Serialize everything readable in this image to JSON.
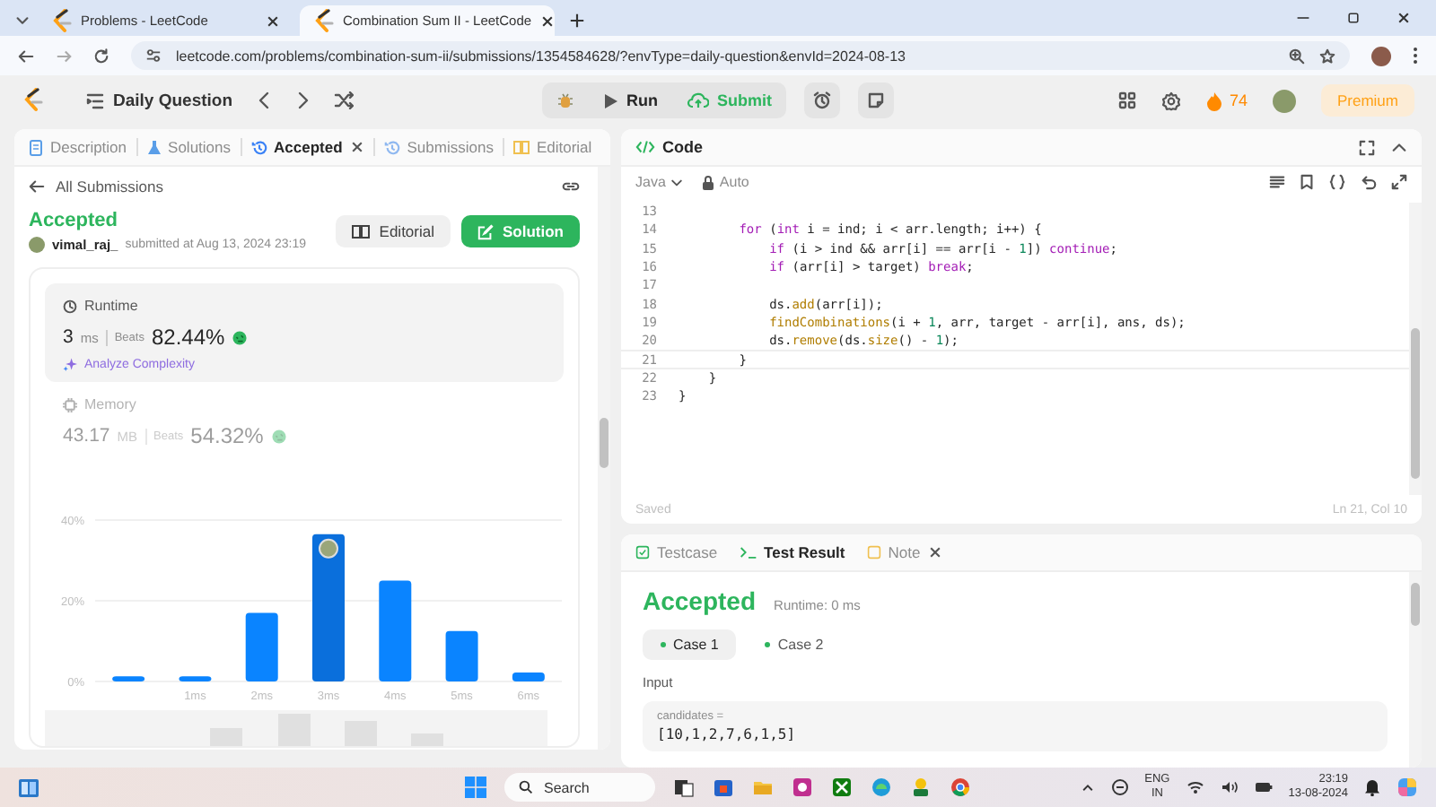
{
  "browser": {
    "tabs": [
      {
        "title": "Problems - LeetCode",
        "selected": false
      },
      {
        "title": "Combination Sum II - LeetCode",
        "selected": true
      }
    ],
    "url": "leetcode.com/problems/combination-sum-ii/submissions/1354584628/?envType=daily-question&envId=2024-08-13"
  },
  "nav": {
    "title": "Daily Question",
    "run": "Run",
    "submit": "Submit",
    "streak": "74",
    "premium": "Premium"
  },
  "submission_panel": {
    "tabs": [
      {
        "label": "Description",
        "selected": false,
        "closable": false
      },
      {
        "label": "Solutions",
        "selected": false,
        "closable": false
      },
      {
        "label": "Accepted",
        "selected": true,
        "closable": true
      },
      {
        "label": "Submissions",
        "selected": false,
        "closable": false
      },
      {
        "label": "Editorial",
        "selected": false,
        "closable": false
      }
    ],
    "back_link": "All Submissions",
    "status": "Accepted",
    "user": "vimal_raj_",
    "submitted": "submitted at Aug 13, 2024 23:19",
    "buttons": [
      "Editorial",
      "Solution"
    ],
    "metrics": [
      {
        "label": "Runtime",
        "value": "3",
        "unit": "ms",
        "beats_label": "Beats",
        "beats": "82.44%",
        "selected": true,
        "link": "Analyze Complexity"
      },
      {
        "label": "Memory",
        "value": "43.17",
        "unit": "MB",
        "beats_label": "Beats",
        "beats": "54.32%",
        "selected": false
      }
    ],
    "chart_data": {
      "type": "bar",
      "categories": [
        null,
        "1ms",
        "2ms",
        "3ms",
        "4ms",
        "5ms",
        "6ms"
      ],
      "values": [
        1.3,
        1.3,
        17,
        36.5,
        25,
        12.5,
        2.2
      ],
      "ylim": [
        0,
        40
      ],
      "yticks": [
        {
          "value": 0,
          "label": "0%"
        },
        {
          "value": 20,
          "label": "20%"
        },
        {
          "value": 40,
          "label": "40%"
        }
      ]
    }
  },
  "code": {
    "title": "Code",
    "language": "Java",
    "mode": "Auto",
    "lines": [
      {
        "number": "13",
        "selected": false
      },
      {
        "number": "14",
        "text": "        for (int i = ind; i < arr.length; i++) {",
        "selected": false
      },
      {
        "number": "15",
        "text": "            if (i > ind && arr[i] == arr[i - 1]) continue;",
        "selected": false
      },
      {
        "number": "16",
        "text": "            if (arr[i] > target) break;",
        "selected": false
      },
      {
        "number": "17",
        "selected": false
      },
      {
        "number": "18",
        "text": "            ds.add(arr[i]);",
        "selected": false
      },
      {
        "number": "19",
        "text": "            findCombinations(i + 1, arr, target - arr[i], ans, ds);",
        "selected": false
      },
      {
        "number": "20",
        "text": "            ds.remove(ds.size() - 1);",
        "selected": false
      },
      {
        "number": "21",
        "text": "        }",
        "selected": true
      },
      {
        "number": "22",
        "text": "    }",
        "selected": false
      },
      {
        "number": "23",
        "text": "}",
        "selected": false
      }
    ],
    "status": "Saved",
    "cursor": "Ln 21, Col 10"
  },
  "test_panel": {
    "tabs": [
      {
        "label": "Testcase",
        "selected": false,
        "closable": false
      },
      {
        "label": "Test Result",
        "selected": true,
        "closable": false
      },
      {
        "label": "Note",
        "selected": false,
        "closable": true
      }
    ],
    "status": "Accepted",
    "runtime": "Runtime: 0 ms",
    "cases": [
      {
        "label": "Case 1",
        "selected": true
      },
      {
        "label": "Case 2",
        "selected": false
      }
    ],
    "input_label": "Input",
    "inputs": [
      {
        "name": "candidates =",
        "value": "[10,1,2,7,6,1,5]"
      }
    ]
  },
  "taskbar": {
    "search": "Search",
    "language": "ENG",
    "region": "IN",
    "time": "23:19",
    "date": "13-08-2024"
  }
}
